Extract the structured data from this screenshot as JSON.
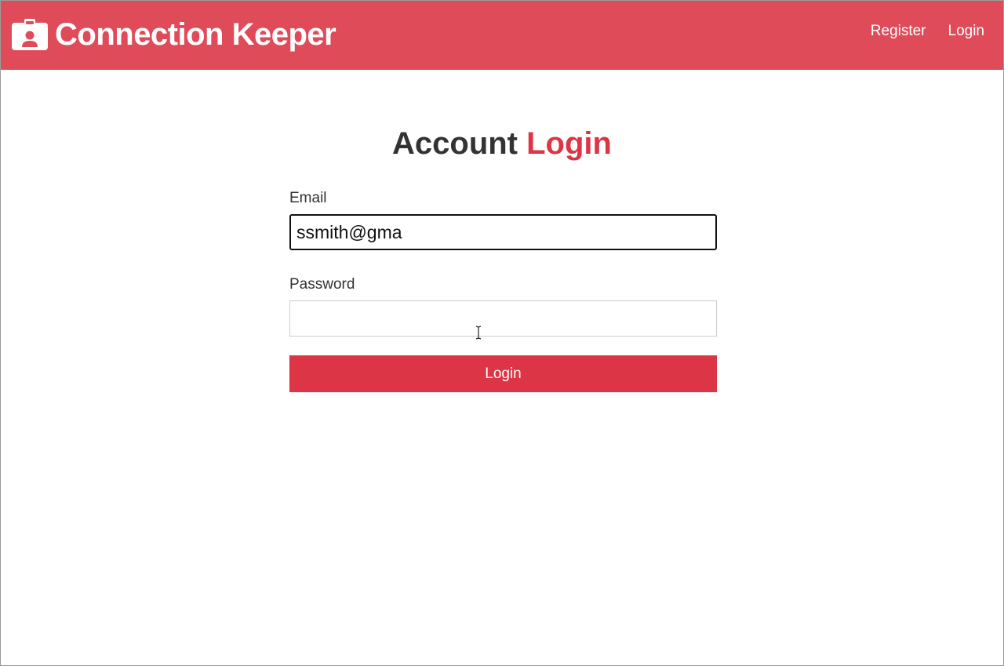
{
  "navbar": {
    "brand_title": "Connection Keeper",
    "brand_icon": "id-badge-icon",
    "links": [
      {
        "label": "Register"
      },
      {
        "label": "Login"
      }
    ],
    "background_color": "#e04b5a"
  },
  "main": {
    "heading_prefix": "Account",
    "heading_accent": "Login",
    "accent_color": "#dc3545"
  },
  "form": {
    "email_label": "Email",
    "email_value": "ssmith@gma",
    "password_label": "Password",
    "password_value": "",
    "submit_label": "Login",
    "button_color": "#dc3545"
  }
}
